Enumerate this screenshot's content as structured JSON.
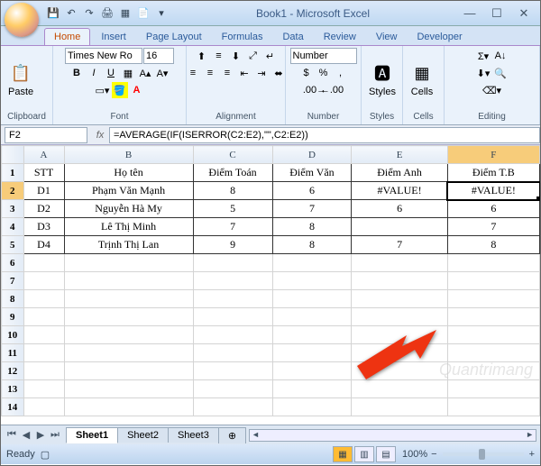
{
  "app": {
    "title": "Book1 - Microsoft Excel"
  },
  "tabs": [
    "Home",
    "Insert",
    "Page Layout",
    "Formulas",
    "Data",
    "Review",
    "View",
    "Developer"
  ],
  "ribbon": {
    "clipboard": {
      "paste": "Paste",
      "label": "Clipboard"
    },
    "font": {
      "name": "Times New Ro",
      "size": "16",
      "label": "Font"
    },
    "alignment": {
      "label": "Alignment"
    },
    "number": {
      "format": "Number",
      "label": "Number"
    },
    "styles": {
      "btn": "Styles",
      "label": "Styles"
    },
    "cells": {
      "btn": "Cells",
      "label": "Cells"
    },
    "editing": {
      "label": "Editing"
    }
  },
  "namebox": "F2",
  "formula": "=AVERAGE(IF(ISERROR(C2:E2),\"\",C2:E2))",
  "columns": [
    "A",
    "B",
    "C",
    "D",
    "E",
    "F"
  ],
  "headers": {
    "A": "STT",
    "B": "Họ tên",
    "C": "Điểm Toán",
    "D": "Điểm Văn",
    "E": "Điểm Anh",
    "F": "Điểm T.B"
  },
  "rows": [
    {
      "A": "D1",
      "B": "Phạm Văn Mạnh",
      "C": "8",
      "D": "6",
      "E": "#VALUE!",
      "F": "#VALUE!"
    },
    {
      "A": "D2",
      "B": "Nguyễn Hà My",
      "C": "5",
      "D": "7",
      "E": "6",
      "F": "6"
    },
    {
      "A": "D3",
      "B": "Lê Thị Minh",
      "C": "7",
      "D": "8",
      "E": "",
      "F": "7"
    },
    {
      "A": "D4",
      "B": "Trịnh Thị Lan",
      "C": "9",
      "D": "8",
      "E": "7",
      "F": "8"
    }
  ],
  "sheets": [
    "Sheet1",
    "Sheet2",
    "Sheet3"
  ],
  "status": {
    "ready": "Ready",
    "zoom": "100%"
  },
  "watermark": "Quantrimang"
}
